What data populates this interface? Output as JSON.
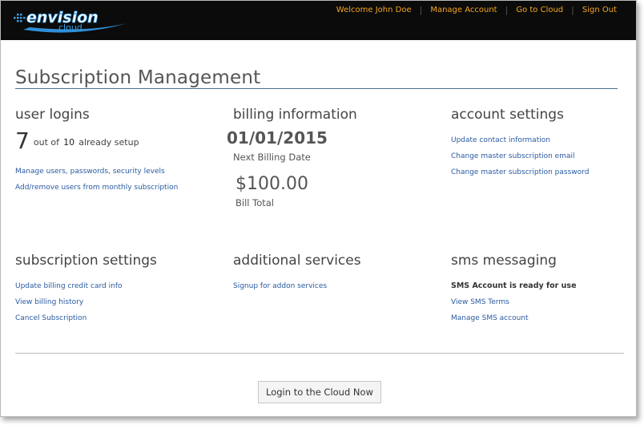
{
  "colors": {
    "accent": "#f5a623",
    "link": "#2a5aa0",
    "topbar": "#0b0b0b",
    "logo": "#3aa0e8"
  },
  "header": {
    "logo_primary": "envision",
    "logo_secondary": "cloud",
    "nav": [
      {
        "label": "Welcome John Doe"
      },
      {
        "label": "Manage Account"
      },
      {
        "label": "Go to Cloud"
      },
      {
        "label": "Sign Out"
      }
    ]
  },
  "page": {
    "title": "Subscription Management"
  },
  "user_logins": {
    "heading": "user logins",
    "used": "7",
    "out_of_text": "out of",
    "total": "10",
    "setup_text": "already setup",
    "links": [
      "Manage users, passwords, security levels",
      "Add/remove users from monthly subscription"
    ]
  },
  "billing": {
    "heading": "billing information",
    "next_date": "01/01/2015",
    "next_date_label": "Next Billing Date",
    "total": "$100.00",
    "total_label": "Bill Total"
  },
  "account_settings": {
    "heading": "account settings",
    "links": [
      "Update contact information",
      "Change master subscription email",
      "Change master subscription password"
    ]
  },
  "subscription_settings": {
    "heading": "subscription settings",
    "links": [
      "Update billing credit card info",
      "View billing history",
      "Cancel Subscription"
    ]
  },
  "additional_services": {
    "heading": "additional services",
    "links": [
      "Signup for addon services"
    ]
  },
  "sms": {
    "heading": "sms messaging",
    "status": "SMS Account is ready for use",
    "links": [
      "View SMS Terms",
      "Manage SMS account"
    ]
  },
  "footer": {
    "button_label": "Login to the Cloud Now"
  }
}
